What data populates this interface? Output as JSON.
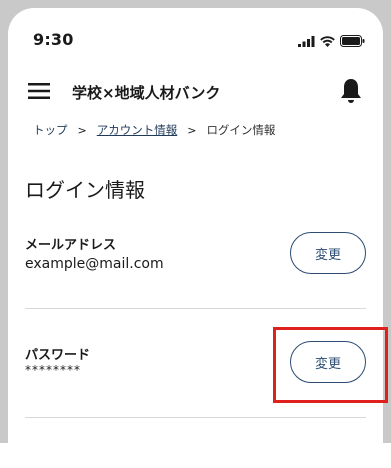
{
  "status_bar": {
    "time": "9:30"
  },
  "header": {
    "title": "学校×地域人材バンク"
  },
  "breadcrumb": {
    "items": [
      "トップ",
      "アカウント情報",
      "ログイン情報"
    ],
    "separator": ">"
  },
  "page": {
    "title": "ログイン情報"
  },
  "email_row": {
    "label": "メールアドレス",
    "value": "example@mail.com",
    "button": "変更"
  },
  "password_row": {
    "label": "パスワード",
    "value": "********",
    "button": "変更"
  },
  "colors": {
    "accent": "#2c4c73",
    "highlight": "#e0201c",
    "divider": "#d8d8d8"
  },
  "icons": [
    "signal-icon",
    "wifi-icon",
    "battery-icon",
    "hamburger-menu-icon",
    "bell-icon"
  ]
}
